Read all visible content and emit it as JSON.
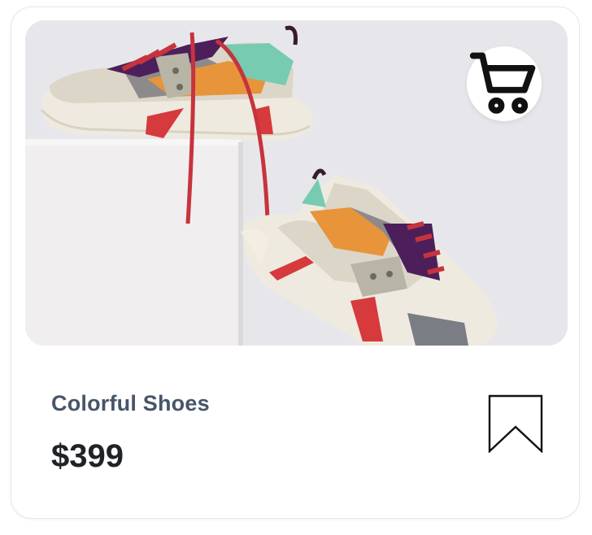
{
  "product": {
    "title": "Colorful Shoes",
    "price": "$399",
    "image_alt": "Colorful sneakers on a white pedestal"
  },
  "icons": {
    "cart": "shopping-cart-icon",
    "bookmark": "bookmark-icon"
  },
  "colors": {
    "title": "#475569",
    "price": "#1f2328",
    "image_background": "#e6e6ea"
  }
}
